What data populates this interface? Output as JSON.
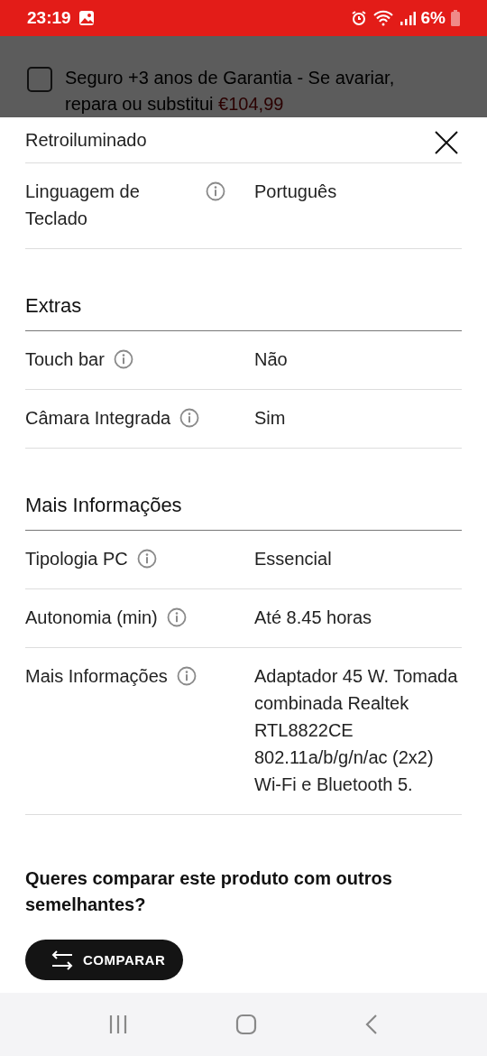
{
  "status_bar": {
    "time": "23:19",
    "battery": "6%"
  },
  "background_page": {
    "option": {
      "label": "Seguro +3 anos de Garantia - Se avariar, repara ou substitui",
      "price": "€104,99",
      "checked": false
    }
  },
  "sheet": {
    "partial_row": {
      "label": "Retroiluminado"
    },
    "rows": [
      {
        "label": "Linguagem de Teclado",
        "value": "Português"
      }
    ],
    "sections": [
      {
        "title": "Extras",
        "rows": [
          {
            "label": "Touch bar",
            "value": "Não"
          },
          {
            "label": "Câmara Integrada",
            "value": "Sim"
          }
        ]
      },
      {
        "title": "Mais Informações",
        "rows": [
          {
            "label": "Tipologia PC",
            "value": "Essencial"
          },
          {
            "label": "Autonomia (min)",
            "value": "Até 8.45 horas"
          },
          {
            "label": "Mais Informações",
            "value": "Adaptador 45 W. Tomada combinada Realtek RTL8822CE 802.11a/b/g/n/ac (2x2) Wi-Fi e Bluetooth 5."
          }
        ]
      }
    ],
    "compare": {
      "question": "Queres comparar este produto com outros semelhantes?",
      "button": "COMPARAR"
    }
  }
}
